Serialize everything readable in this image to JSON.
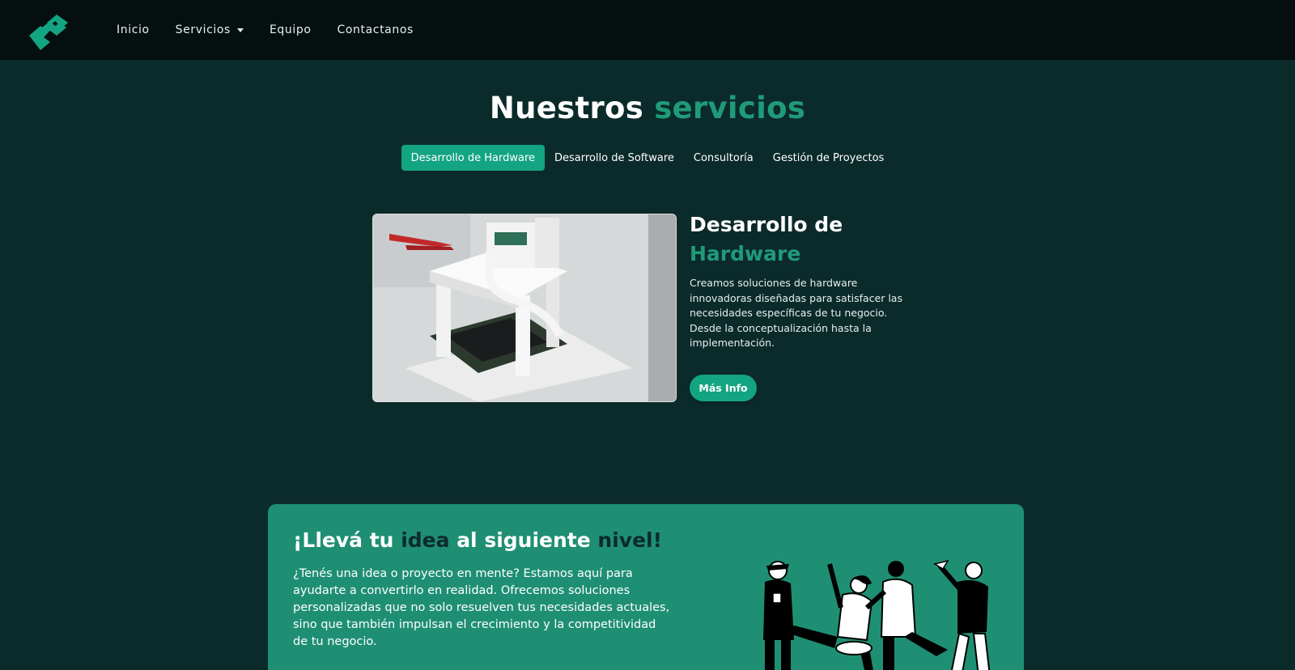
{
  "nav": {
    "items": [
      "Inicio",
      "Servicios",
      "Equipo",
      "Contactanos"
    ],
    "logo_icon": "brand-logo-icon",
    "dropdown_icon": "caret-down-icon"
  },
  "services": {
    "title_main": "Nuestros",
    "title_accent": "servicios",
    "tabs": [
      "Desarrollo de Hardware",
      "Desarrollo de Software",
      "Consultoría",
      "Gestión de Proyectos"
    ],
    "active_tab": "Desarrollo de Hardware",
    "detail": {
      "title_line1": "Desarrollo de",
      "title_line2": "Hardware",
      "description": "Creamos soluciones de hardware innovadoras diseñadas para satisfacer las necesidades específicas de tu negocio. Desde la conceptualización hasta la implementación.",
      "button": "Más Info"
    }
  },
  "cta": {
    "title_part1": "¡Llevá tu ",
    "title_idea": "idea",
    "title_part2": " al siguiente ",
    "title_nivel": "nivel!",
    "text": "¿Tenés una idea o proyecto en mente? Estamos aquí para ayudarte a convertirlo en realidad. Ofrecemos soluciones personalizadas que no solo resuelven tus necesidades actuales, sino que también impulsan el crecimiento y la competitividad de tu negocio."
  },
  "colors": {
    "background": "#0b2b2a",
    "navbar": "#050f10",
    "accent": "#1f9b7a",
    "button": "#13a481",
    "cta": "#1f8f74"
  }
}
